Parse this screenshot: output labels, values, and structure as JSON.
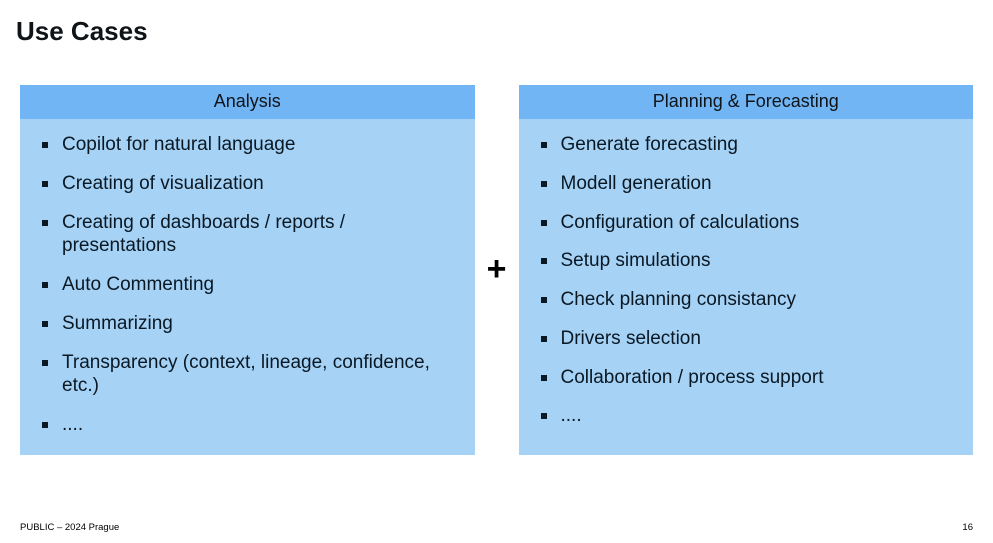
{
  "title": "Use Cases",
  "left": {
    "header": "Analysis",
    "items": [
      "Copilot for natural language",
      "Creating of visualization",
      "Creating of dashboards / reports / presentations",
      "Auto Commenting",
      "Summarizing",
      "Transparency (context, lineage, confidence, etc.)",
      "...."
    ]
  },
  "plus": "+",
  "right": {
    "header": "Planning & Forecasting",
    "items": [
      "Generate forecasting",
      "Modell generation",
      "Configuration of calculations",
      "Setup simulations",
      "Check planning consistancy",
      "Drivers selection",
      "Collaboration / process support",
      "...."
    ]
  },
  "footer": {
    "left": "PUBLIC – 2024 Prague",
    "right": "16"
  }
}
